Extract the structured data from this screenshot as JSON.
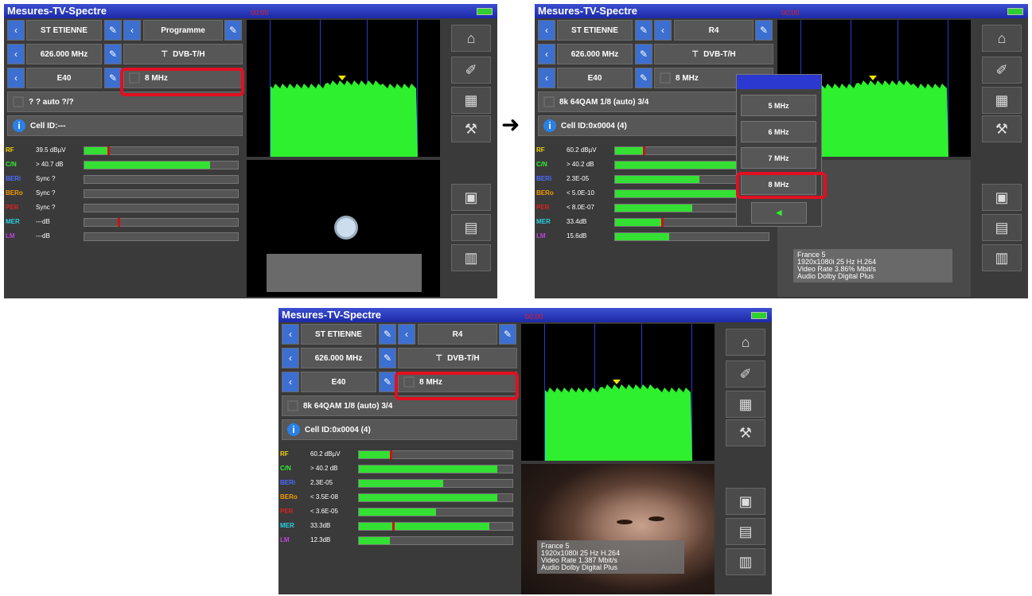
{
  "arrow_glyph": "➜",
  "screens": [
    {
      "title": "Mesures-TV-Spectre",
      "clock": "00:00",
      "location": "ST ETIENNE",
      "program": "Programme",
      "frequency": "626.000 MHz",
      "standard": "DVB-T/H",
      "channel": "E40",
      "bandwidth": "8 MHz",
      "modulation": "? ? auto ?/?",
      "cell": "Cell ID:---",
      "meters": [
        {
          "label": "RF",
          "value": "39.5 dBµV",
          "color": "#f2d400",
          "fill": 0.15,
          "red": 0.15
        },
        {
          "label": "C/N",
          "value": "> 40.7 dB",
          "color": "#2ef02e",
          "fill": 0.82,
          "red": null
        },
        {
          "label": "BERi",
          "value": "Sync ?",
          "color": "#4a6cff",
          "fill": 0.0,
          "red": null
        },
        {
          "label": "BERo",
          "value": "Sync ?",
          "color": "#f29a00",
          "fill": 0.0,
          "red": null
        },
        {
          "label": "PER",
          "value": "Sync ?",
          "color": "#e02020",
          "fill": 0.0,
          "red": null
        },
        {
          "label": "MER",
          "value": "---dB",
          "color": "#2ad0e0",
          "fill": 0.0,
          "red": 0.22
        },
        {
          "label": "LM",
          "value": "---dB",
          "color": "#c040e0",
          "fill": 0.0,
          "red": null
        }
      ]
    },
    {
      "title": "Mesures-TV-Spectre",
      "clock": "00:00",
      "location": "ST ETIENNE",
      "program": "R4",
      "frequency": "626.000 MHz",
      "standard": "DVB-T/H",
      "channel": "E40",
      "bandwidth": "8 MHz",
      "modulation": "8k 64QAM 1/8 (auto) 3/4",
      "cell": "Cell ID:0x0004 (4)",
      "popup_items": [
        "5 MHz",
        "6 MHz",
        "7 MHz",
        "8 MHz"
      ],
      "meters": [
        {
          "label": "RF",
          "value": "60.2 dBµV",
          "color": "#f2d400",
          "fill": 0.18,
          "red": 0.18
        },
        {
          "label": "C/N",
          "value": "> 40.2 dB",
          "color": "#2ef02e",
          "fill": 0.9,
          "red": null
        },
        {
          "label": "BERi",
          "value": "2.3E-05",
          "color": "#4a6cff",
          "fill": 0.55,
          "red": null
        },
        {
          "label": "BERo",
          "value": "< 5.0E-10",
          "color": "#f29a00",
          "fill": 0.9,
          "red": null
        },
        {
          "label": "PER",
          "value": "< 8.0E-07",
          "color": "#e02020",
          "fill": 0.5,
          "red": null
        },
        {
          "label": "MER",
          "value": "33.4dB",
          "color": "#2ad0e0",
          "fill": 0.3,
          "red": 0.3
        },
        {
          "label": "LM",
          "value": "15.6dB",
          "color": "#c040e0",
          "fill": 0.35,
          "red": null
        }
      ],
      "info": [
        "France 5",
        "1920x1080i 25 Hz H.264",
        "Video Rate 3.86% Mbit/s",
        "Audio Dolby Digital Plus"
      ]
    },
    {
      "title": "Mesures-TV-Spectre",
      "clock": "00:00",
      "location": "ST ETIENNE",
      "program": "R4",
      "frequency": "626.000 MHz",
      "standard": "DVB-T/H",
      "channel": "E40",
      "bandwidth": "8 MHz",
      "modulation": "8k 64QAM 1/8 (auto) 3/4",
      "cell": "Cell ID:0x0004 (4)",
      "meters": [
        {
          "label": "RF",
          "value": "60.2 dBµV",
          "color": "#f2d400",
          "fill": 0.2,
          "red": 0.2
        },
        {
          "label": "C/N",
          "value": "> 40.2 dB",
          "color": "#2ef02e",
          "fill": 0.9,
          "red": null
        },
        {
          "label": "BERi",
          "value": "2.3E-05",
          "color": "#4a6cff",
          "fill": 0.55,
          "red": null
        },
        {
          "label": "BERo",
          "value": "< 3.5E-08",
          "color": "#f29a00",
          "fill": 0.9,
          "red": null
        },
        {
          "label": "PER",
          "value": "< 3.6E-05",
          "color": "#e02020",
          "fill": 0.5,
          "red": null
        },
        {
          "label": "MER",
          "value": "33.3dB",
          "color": "#2ad0e0",
          "fill": 0.85,
          "red": 0.22
        },
        {
          "label": "LM",
          "value": "12.3dB",
          "color": "#c040e0",
          "fill": 0.2,
          "red": null
        }
      ],
      "info": [
        "France 5",
        "1920x1080i 25 Hz H.264",
        "Video Rate 1.387 Mbit/s",
        "Audio Dolby Digital Plus"
      ]
    }
  ]
}
